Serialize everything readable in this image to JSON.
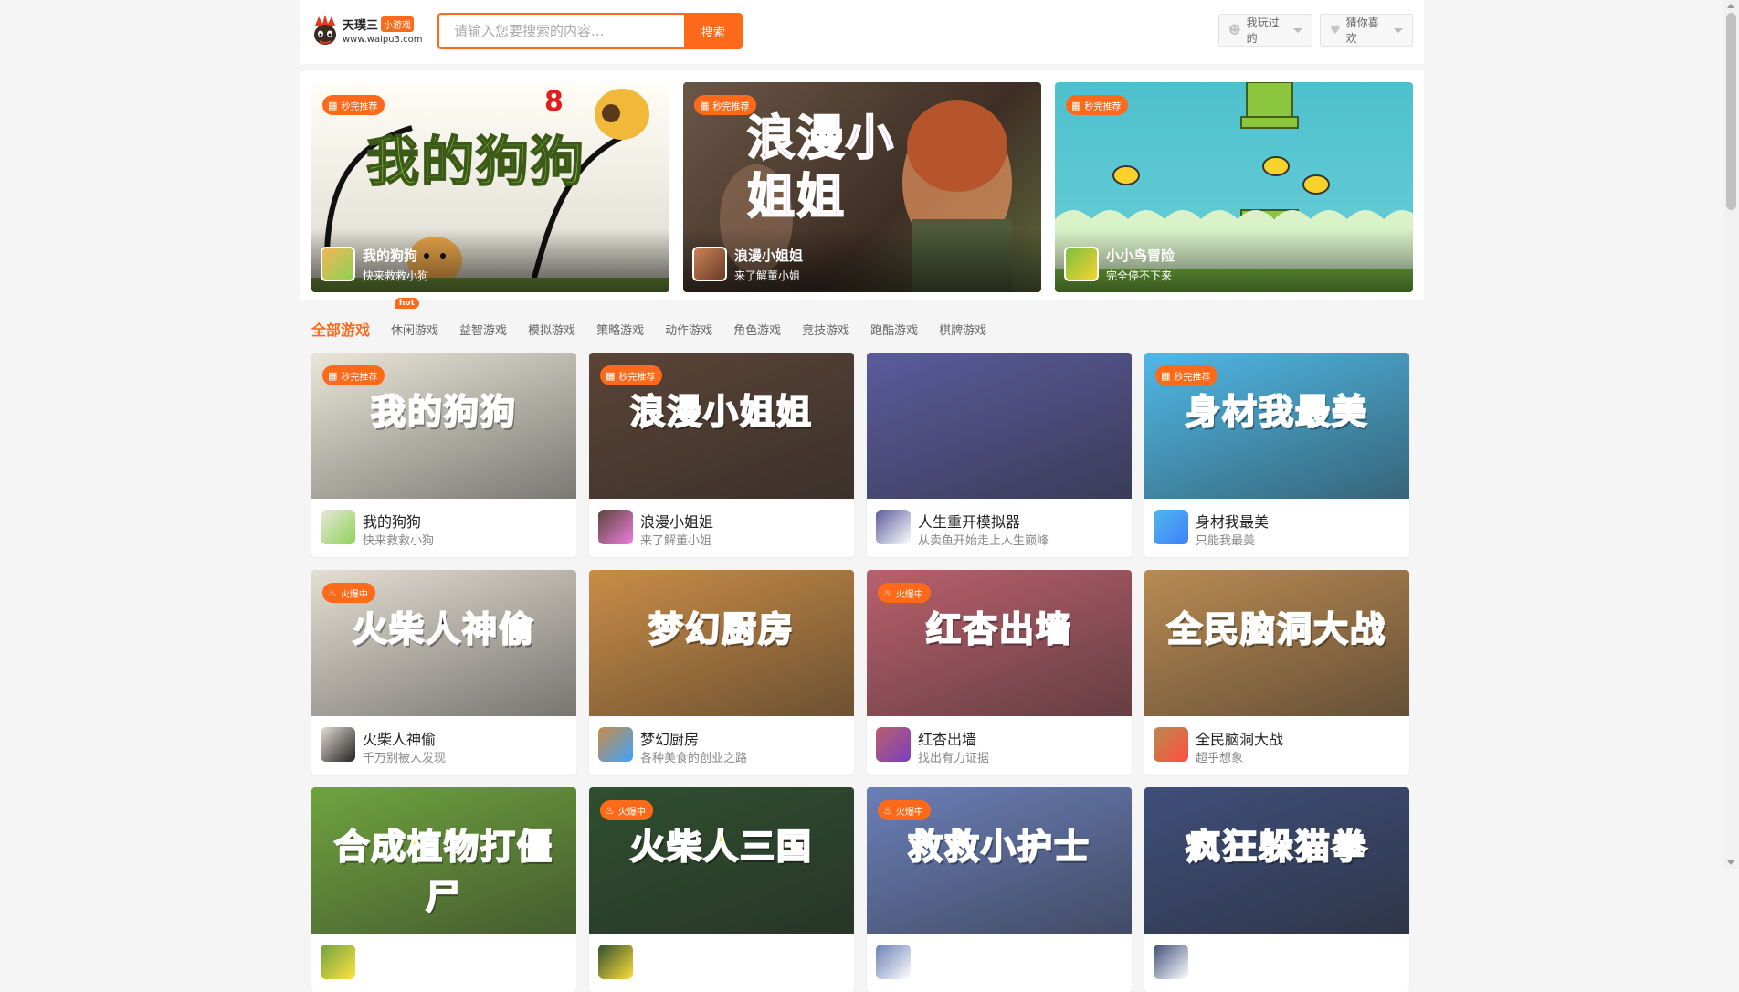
{
  "header": {
    "logo_name": "天璞三",
    "logo_tag": "小游戏",
    "logo_url": "www.waipu3.com",
    "search_placeholder": "请输入您要搜索的内容...",
    "search_button": "搜索",
    "played_label": "我玩过的",
    "liked_label": "猜你喜欢"
  },
  "featured": [
    {
      "badge": "秒完推荐",
      "title": "我的狗狗",
      "subtitle": "快来救救小狗",
      "art": "我的狗狗"
    },
    {
      "badge": "秒完推荐",
      "title": "浪漫小姐姐",
      "subtitle": "来了解董小姐",
      "art": "浪漫小姐姐"
    },
    {
      "badge": "秒完推荐",
      "title": "小小鸟冒险",
      "subtitle": "完全停不下来",
      "art": ""
    }
  ],
  "categories": [
    {
      "label": "全部游戏",
      "active": true
    },
    {
      "label": "休闲游戏",
      "hot": "hot"
    },
    {
      "label": "益智游戏"
    },
    {
      "label": "模拟游戏"
    },
    {
      "label": "策略游戏"
    },
    {
      "label": "动作游戏"
    },
    {
      "label": "角色游戏"
    },
    {
      "label": "竞技游戏"
    },
    {
      "label": "跑酷游戏"
    },
    {
      "label": "棋牌游戏"
    }
  ],
  "games": [
    {
      "title": "我的狗狗",
      "subtitle": "快来救救小狗",
      "badge": "秒完推荐",
      "art": "我的狗狗",
      "bg": "#e9e6d8",
      "fg": "#8fd45a"
    },
    {
      "title": "浪漫小姐姐",
      "subtitle": "来了解董小姐",
      "badge": "秒完推荐",
      "art": "浪漫小姐姐",
      "bg": "#5b4436",
      "fg": "#ee7fe0"
    },
    {
      "title": "人生重开模拟器",
      "subtitle": "从卖鱼开始走上人生巅峰",
      "badge": "",
      "art": "",
      "bg": "#5a5b9c",
      "fg": "#ffffff"
    },
    {
      "title": "身材我最美",
      "subtitle": "只能我最美",
      "badge": "秒完推荐",
      "art": "身材我最美",
      "bg": "#4fb8e6",
      "fg": "#3f7fff"
    },
    {
      "title": "火柴人神偷",
      "subtitle": "千万别被人发现",
      "badge": "火爆中",
      "art": "火柴人神偷",
      "bg": "#e3ded3",
      "fg": "#222222"
    },
    {
      "title": "梦幻厨房",
      "subtitle": "各种美食的创业之路",
      "badge": "",
      "art": "梦幻厨房",
      "bg": "#c98c46",
      "fg": "#3fa3ff"
    },
    {
      "title": "红杏出墙",
      "subtitle": "找出有力证据",
      "badge": "火爆中",
      "art": "红杏出墙",
      "bg": "#b9606c",
      "fg": "#7b3fc0"
    },
    {
      "title": "全民脑洞大战",
      "subtitle": "超乎想象",
      "badge": "",
      "art": "全民脑洞大战",
      "bg": "#b98a52",
      "fg": "#ff4f3f"
    },
    {
      "title": "",
      "subtitle": "",
      "badge": "",
      "art": "合成植物打僵尸",
      "bg": "#6fa33f",
      "fg": "#ffe23f"
    },
    {
      "title": "",
      "subtitle": "",
      "badge": "火爆中",
      "art": "火柴人三国",
      "bg": "#2f4f2f",
      "fg": "#ffde3a"
    },
    {
      "title": "",
      "subtitle": "",
      "badge": "火爆中",
      "art": "救救小护士",
      "bg": "#6a7fb8",
      "fg": "#ffffff"
    },
    {
      "title": "",
      "subtitle": "",
      "badge": "",
      "art": "疯狂躲猫拳",
      "bg": "#3f4f7a",
      "fg": "#ffffff"
    }
  ],
  "colors": {
    "accent": "#ff6a1a"
  },
  "icons": {
    "badge_pick": "gamepad-icon",
    "badge_hot": "flame-icon"
  }
}
